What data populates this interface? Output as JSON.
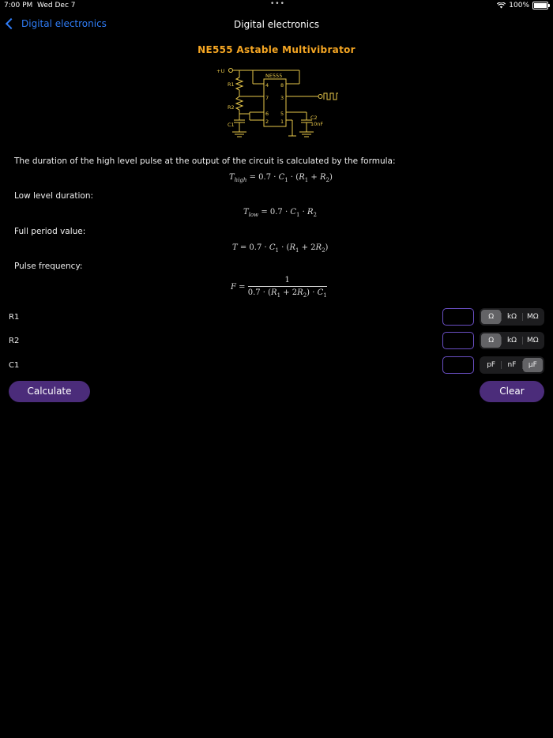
{
  "status": {
    "time": "7:00 PM",
    "date": "Wed Dec 7",
    "dots": "•••",
    "battery": "100%"
  },
  "nav": {
    "back_label": "Digital electronics",
    "title": "Digital electronics"
  },
  "heading": "NE555 Astable Multivibrator",
  "circuit": {
    "supply": "+U",
    "chip": "NE555",
    "r1": "R1",
    "r2": "R2",
    "c1": "C1",
    "c2": "C2",
    "c2_value": "10nF",
    "pins_left": [
      "4",
      "7",
      "6",
      "2"
    ],
    "pins_right": [
      "8",
      "3",
      "5",
      "1"
    ]
  },
  "text": {
    "intro": "The duration of the high level pulse at the output of the circuit is calculated by the formula:",
    "low": "Low level duration:",
    "full": "Full period value:",
    "freq": "Pulse frequency:"
  },
  "formulas": {
    "high": "T_high = 0.7 · C1 · (R1 + R2)",
    "low": "T_low = 0.7 · C1 · R2",
    "period": "T = 0.7 · C1 · (R1 + 2R2)",
    "freq": "F = 1 / (0.7 · (R1 + 2R2) · C1)"
  },
  "inputs": [
    {
      "label": "R1",
      "value": "",
      "units": [
        "Ω",
        "kΩ",
        "MΩ"
      ],
      "selected": 0
    },
    {
      "label": "R2",
      "value": "",
      "units": [
        "Ω",
        "kΩ",
        "MΩ"
      ],
      "selected": 0
    },
    {
      "label": "C1",
      "value": "",
      "units": [
        "pF",
        "nF",
        "µF"
      ],
      "selected": 2
    }
  ],
  "buttons": {
    "calculate": "Calculate",
    "clear": "Clear"
  },
  "colors": {
    "accent": "#f5a623",
    "link": "#2f7cf6",
    "button": "#4b2c7a",
    "input_border": "#6a4fc4",
    "circuit": "#e7c74a"
  }
}
